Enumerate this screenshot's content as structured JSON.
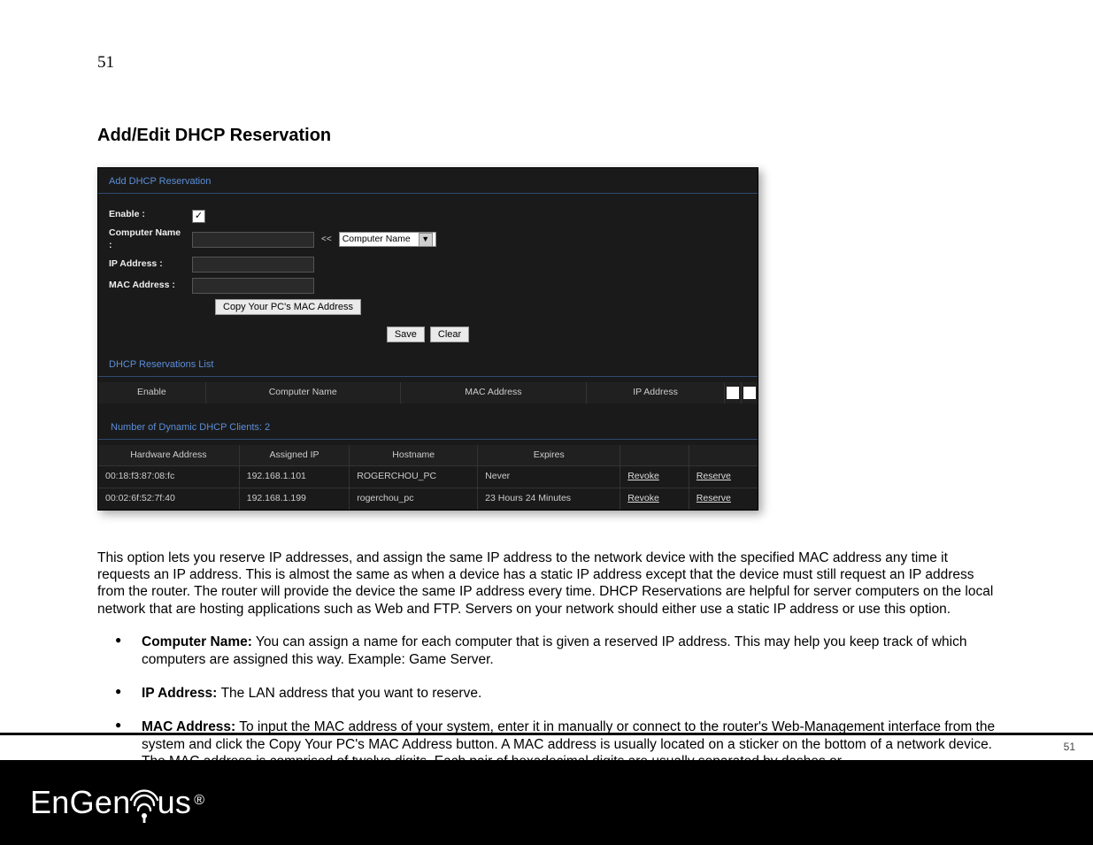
{
  "page": {
    "number_top": "51",
    "number_footer": "51"
  },
  "section_heading": "Add/Edit DHCP Reservation",
  "router_ui": {
    "add_section_title": "Add DHCP Reservation",
    "labels": {
      "enable": "Enable :",
      "computer_name": "Computer Name :",
      "ip_address": "IP Address :",
      "mac_address": "MAC Address :"
    },
    "inputs": {
      "enable_checked": "✓",
      "computer_name_value": "",
      "ip_address_value": "",
      "mac_address_value": "",
      "computer_dropdown_selected": "Computer Name",
      "insert_arrow": "<<"
    },
    "buttons": {
      "copy_mac": "Copy Your PC's MAC Address",
      "save": "Save",
      "clear": "Clear"
    },
    "reservations_list_title": "DHCP Reservations List",
    "reservations_headers": [
      "Enable",
      "Computer Name",
      "MAC Address",
      "IP Address"
    ],
    "dyn_clients_label": "Number of Dynamic DHCP Clients: 2",
    "clients_headers": [
      "Hardware Address",
      "Assigned IP",
      "Hostname",
      "Expires",
      "",
      ""
    ],
    "clients_rows": [
      {
        "hw": "00:18:f3:87:08:fc",
        "ip": "192.168.1.101",
        "host": "ROGERCHOU_PC",
        "exp": "Never",
        "a1": "Revoke",
        "a2": "Reserve"
      },
      {
        "hw": "00:02:6f:52:7f:40",
        "ip": "192.168.1.199",
        "host": "rogerchou_pc",
        "exp": "23 Hours 24 Minutes",
        "a1": "Revoke",
        "a2": "Reserve"
      }
    ]
  },
  "body": {
    "intro": "This option lets you reserve IP addresses, and assign the same IP address to the network device with the specified MAC address any time it requests an IP address. This is almost the same as when a device has a static IP address except that the device must still request an IP address from the router. The router will provide the device the same IP address every time. DHCP Reservations are helpful for server computers on the local network that are hosting applications such as Web and FTP. Servers on your network should either use a static IP address or use this option.",
    "items": [
      {
        "label": "Computer Name:",
        "text": " You can assign a name for each computer that is given a reserved IP address. This may help you keep track of which computers are assigned this way. Example: Game Server."
      },
      {
        "label": "IP Address: ",
        "text": " The LAN address that you want to reserve."
      },
      {
        "label": "MAC Address:",
        "text": " To input the MAC address of your system, enter it in manually or connect to the router's Web-Management interface from the system and click the Copy Your PC's MAC Address button. A MAC address is usually located on a sticker on the bottom of a network device. The MAC address is comprised of twelve digits. Each pair of hexadecimal digits are usually separated by dashes or"
      }
    ]
  },
  "logo": {
    "part1": "EnGen",
    "part2": "us"
  }
}
